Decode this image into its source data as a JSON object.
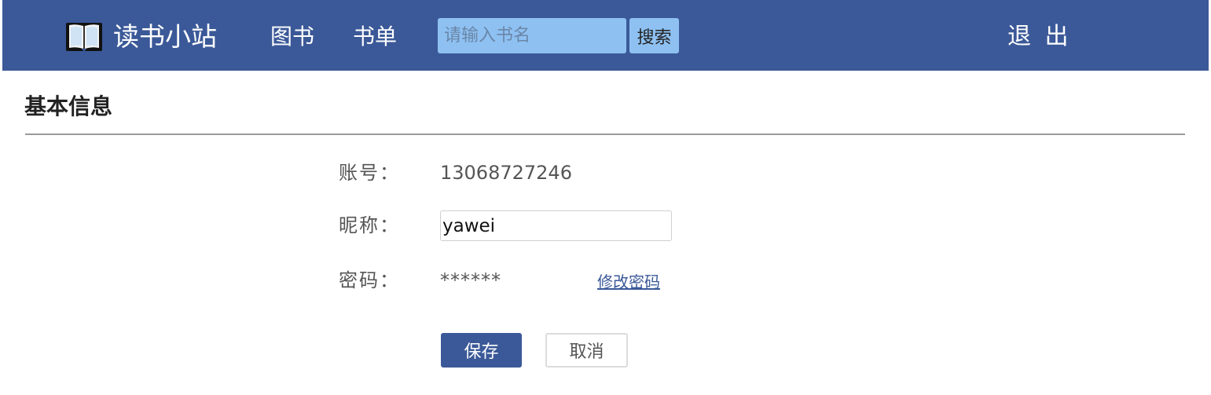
{
  "navbar": {
    "brand": {
      "icon": "open-book-icon",
      "title": "读书小站"
    },
    "links": [
      {
        "label": "图书"
      },
      {
        "label": "书单"
      }
    ],
    "search": {
      "placeholder": "请输入书名",
      "value": "",
      "button_label": "搜索"
    },
    "logout_label": "退 出",
    "colors": {
      "background": "#3b5998",
      "search_background": "#8ec1f2"
    }
  },
  "profile": {
    "section_title": "基本信息",
    "fields": {
      "account": {
        "label": "账号：",
        "value": "13068727246"
      },
      "nickname": {
        "label": "昵称：",
        "value": "yawei"
      },
      "password": {
        "label": "密码：",
        "value": "******",
        "change_link": "修改密码"
      }
    },
    "actions": {
      "save_label": "保存",
      "cancel_label": "取消"
    }
  }
}
